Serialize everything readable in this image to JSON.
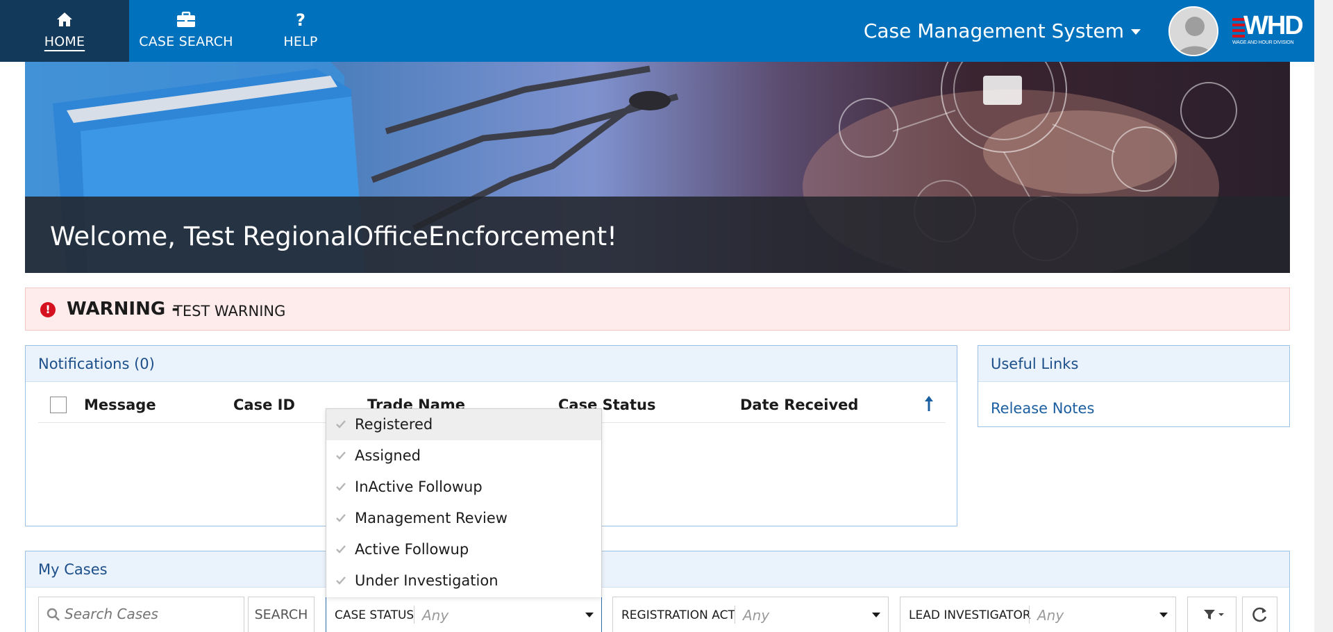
{
  "nav": {
    "items": [
      {
        "label": "HOME",
        "icon": "home-icon"
      },
      {
        "label": "CASE SEARCH",
        "icon": "briefcase-icon"
      },
      {
        "label": "HELP",
        "icon": "question-icon"
      }
    ],
    "app_title": "Case Management System",
    "logo_text": "WHD",
    "logo_subtext": "WAGE AND HOUR DIVISION"
  },
  "hero": {
    "welcome": "Welcome, Test RegionalOfficeEncforcement!"
  },
  "warning": {
    "title": "WARNING -",
    "text": "TEST WARNING"
  },
  "notifications": {
    "title": "Notifications (0)",
    "columns": [
      "Message",
      "Case ID",
      "Trade Name",
      "Case Status",
      "Date Received"
    ]
  },
  "useful_links": {
    "title": "Useful Links",
    "links": [
      "Release Notes"
    ]
  },
  "my_cases": {
    "title": "My Cases",
    "search_placeholder": "Search Cases",
    "search_button": "SEARCH",
    "filters": [
      {
        "label": "CASE STATUS",
        "value": "Any"
      },
      {
        "label": "REGISTRATION ACT",
        "value": "Any"
      },
      {
        "label": "LEAD INVESTIGATOR",
        "value": "Any"
      }
    ],
    "status_options": [
      "Registered",
      "Assigned",
      "InActive Followup",
      "Management Review",
      "Active Followup",
      "Under Investigation"
    ]
  },
  "colors": {
    "nav_bg": "#0071bc",
    "nav_active_bg": "#12385a",
    "panel_header_bg": "#eaf2fb",
    "panel_title": "#1c4f8a",
    "warning_bg": "#fdeceb",
    "warning_icon": "#d5111f"
  }
}
